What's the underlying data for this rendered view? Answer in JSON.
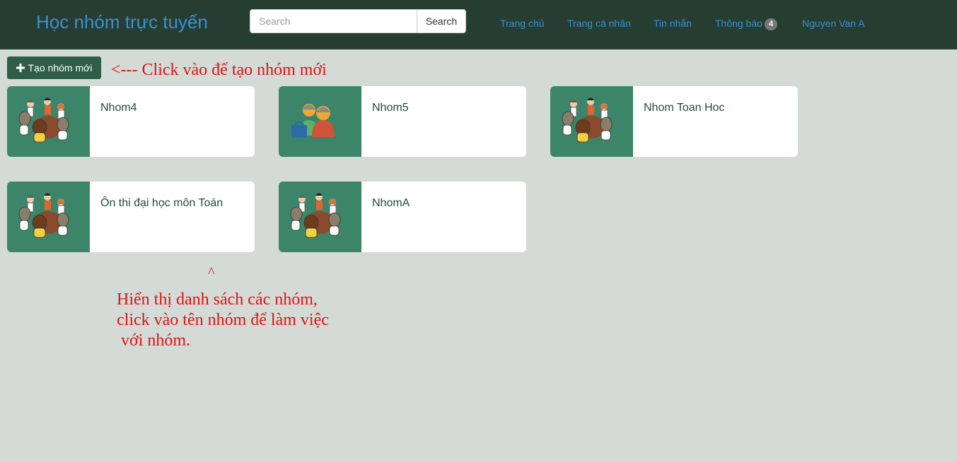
{
  "nav": {
    "brand": "Học nhóm trực tuyến",
    "search": {
      "placeholder": "Search",
      "button": "Search"
    },
    "links": {
      "home": "Trang chủ",
      "profile": "Trang cá nhân",
      "messages": "Tin nhắn",
      "notifications": "Thông báo",
      "notifications_count": "4",
      "user": "Nguyen Van A"
    }
  },
  "create_button": {
    "label": "Tạo nhóm mới",
    "icon": "plus-icon"
  },
  "annotations": {
    "create_hint": "<---  Click vào để tạo nhóm mới",
    "caret": "^",
    "list_hint": "Hiển thị danh sách các nhóm,\nclick vào tên nhóm để làm việc\n với nhóm."
  },
  "groups": [
    {
      "name": "Nhom4",
      "icon": "group-meeting-icon"
    },
    {
      "name": "Nhom5",
      "icon": "two-people-icon"
    },
    {
      "name": "Nhom Toan Hoc",
      "icon": "group-meeting-icon"
    },
    {
      "name": "Ôn thi đại học môn Toán",
      "icon": "group-meeting-icon"
    },
    {
      "name": "NhomA",
      "icon": "group-meeting-icon"
    }
  ],
  "colors": {
    "navbar": "#263d32",
    "link": "#3d8fd1",
    "background": "#d4dad6",
    "card_image_bg": "#3c856a",
    "button": "#2e5e49",
    "annotation": "#e01414"
  }
}
